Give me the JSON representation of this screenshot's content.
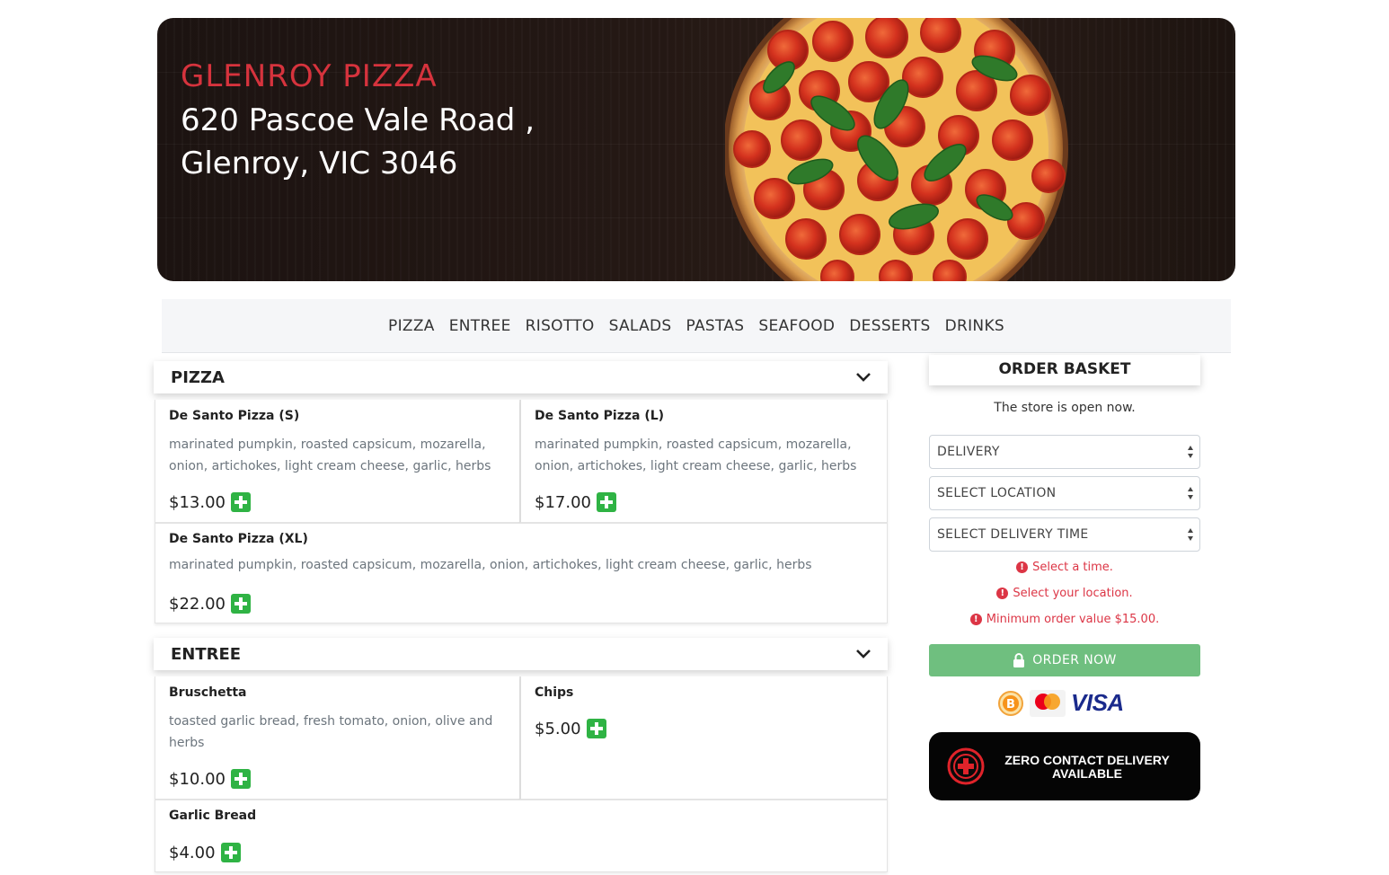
{
  "hero": {
    "title": "GLENROY PIZZA",
    "address_line1": "620 Pascoe Vale Road ,",
    "address_line2": "Glenroy, VIC 3046"
  },
  "nav": [
    "PIZZA",
    "ENTREE",
    "RISOTTO",
    "SALADS",
    "PASTAS",
    "SEAFOOD",
    "DESSERTS",
    "DRINKS"
  ],
  "sections": [
    {
      "title": "PIZZA",
      "items": [
        {
          "name": "De Santo Pizza (S)",
          "desc_line1": "marinated pumpkin, roasted capsicum, mozarella,",
          "desc_line2": "onion, artichokes, light cream cheese, garlic, herbs",
          "price": "$13.00"
        },
        {
          "name": "De Santo Pizza (L)",
          "desc_line1": "marinated pumpkin, roasted capsicum, mozarella,",
          "desc_line2": "onion, artichokes, light cream cheese, garlic, herbs",
          "price": "$17.00"
        },
        {
          "name": "De Santo Pizza (XL)",
          "desc_line1": "marinated pumpkin, roasted capsicum, mozarella, onion, artichokes, light cream cheese, garlic, herbs",
          "price": "$22.00"
        }
      ]
    },
    {
      "title": "ENTREE",
      "items": [
        {
          "name": "Bruschetta",
          "desc_line1": "toasted garlic bread, fresh tomato, onion, olive and",
          "desc_line2": "herbs",
          "price": "$10.00"
        },
        {
          "name": "Chips",
          "price": "$5.00"
        },
        {
          "name": "Garlic Bread",
          "price": "$4.00"
        }
      ]
    }
  ],
  "basket": {
    "title": "ORDER BASKET",
    "status": "The store is open now.",
    "order_type": "DELIVERY",
    "location": "SELECT LOCATION",
    "delivery_time": "SELECT DELIVERY TIME",
    "errors": [
      "Select a time.",
      "Select your location.",
      "Minimum order value $15.00."
    ],
    "order_button": "ORDER NOW",
    "payment_methods": [
      "bitcoin-icon",
      "mastercard-icon",
      "VISA"
    ],
    "zero_contact_line1": "ZERO CONTACT DELIVERY",
    "zero_contact_line2": "AVAILABLE"
  },
  "colors": {
    "brand_red": "#d6333d",
    "add_green": "#2fb344",
    "order_green": "#6fbf7f",
    "error_red": "#dc3545"
  }
}
